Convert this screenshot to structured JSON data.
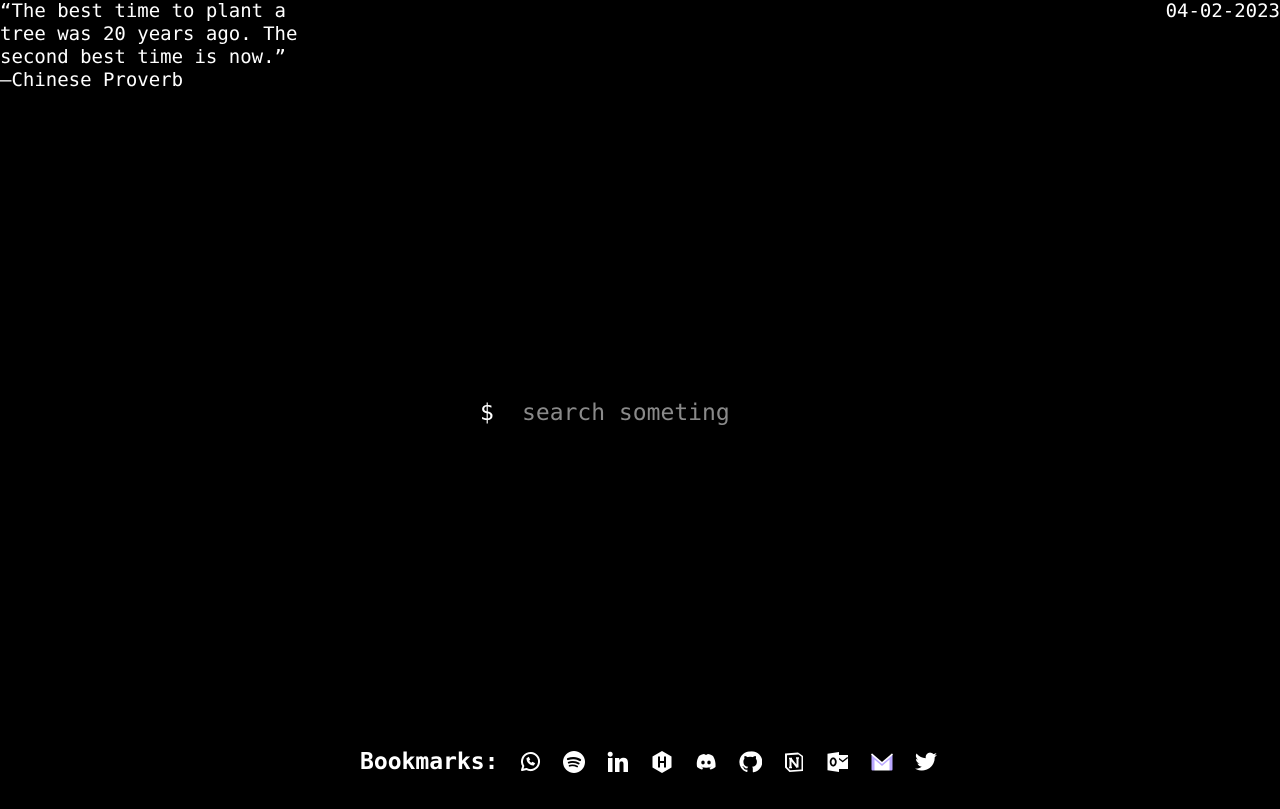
{
  "quote": {
    "text": "“The best time to plant a tree was 20 years ago. The second best time is now.”",
    "author": "—Chinese Proverb"
  },
  "date": "04-02-2023",
  "search": {
    "prompt": "$",
    "placeholder": "search someting"
  },
  "bookmarks": {
    "label": "Bookmarks:",
    "items": [
      {
        "icon": "whatsapp-icon"
      },
      {
        "icon": "spotify-icon"
      },
      {
        "icon": "linkedin-icon"
      },
      {
        "icon": "hackerrank-icon"
      },
      {
        "icon": "discord-icon"
      },
      {
        "icon": "github-icon"
      },
      {
        "icon": "notion-icon"
      },
      {
        "icon": "outlook-icon"
      },
      {
        "icon": "proton-mail-icon",
        "color": "#b9a7ff"
      },
      {
        "icon": "twitter-icon"
      }
    ]
  }
}
